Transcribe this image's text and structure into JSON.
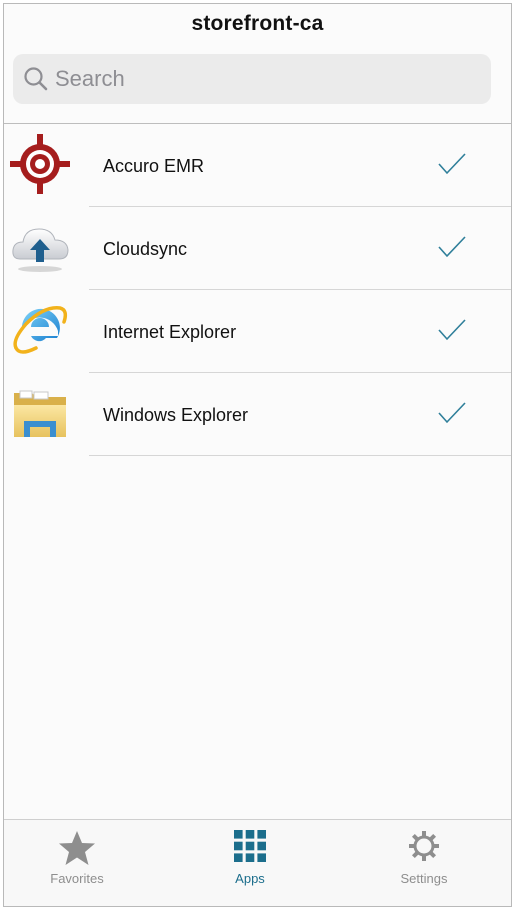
{
  "header": {
    "title": "storefront-ca"
  },
  "search": {
    "placeholder": "Search",
    "value": ""
  },
  "apps": [
    {
      "name": "Accuro EMR",
      "icon": "accuro-target-icon",
      "selected": true
    },
    {
      "name": "Cloudsync",
      "icon": "cloud-upload-icon",
      "selected": true
    },
    {
      "name": "Internet Explorer",
      "icon": "internet-explorer-icon",
      "selected": true
    },
    {
      "name": "Windows Explorer",
      "icon": "folder-icon",
      "selected": true
    }
  ],
  "tabbar": {
    "tabs": [
      {
        "label": "Favorites",
        "icon": "star-icon",
        "active": false
      },
      {
        "label": "Apps",
        "icon": "grid-icon",
        "active": true
      },
      {
        "label": "Settings",
        "icon": "gear-icon",
        "active": false
      }
    ]
  },
  "colors": {
    "accent": "#1c6e8c",
    "check": "#2f7f9a",
    "inactive": "#8e8e8e",
    "separator": "#d6d6d6"
  }
}
